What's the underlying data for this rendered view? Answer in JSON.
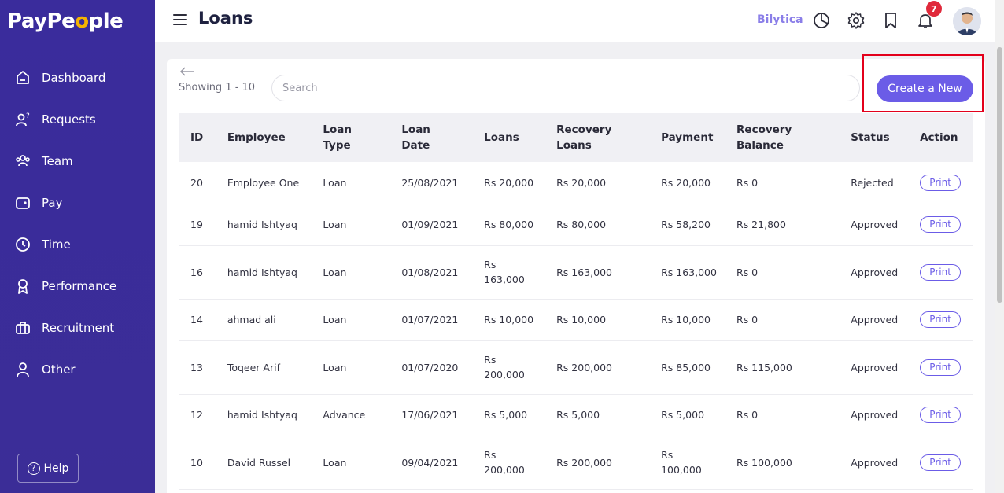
{
  "app": {
    "logo_prefix": "PayPe",
    "logo_o": "o",
    "logo_suffix": "ple"
  },
  "sidebar": {
    "items": [
      {
        "label": "Dashboard",
        "icon": "home-icon"
      },
      {
        "label": "Requests",
        "icon": "user-question-icon"
      },
      {
        "label": "Team",
        "icon": "team-icon"
      },
      {
        "label": "Pay",
        "icon": "wallet-icon"
      },
      {
        "label": "Time",
        "icon": "clock-icon"
      },
      {
        "label": "Performance",
        "icon": "award-icon"
      },
      {
        "label": "Recruitment",
        "icon": "briefcase-icon"
      },
      {
        "label": "Other",
        "icon": "user-icon"
      }
    ],
    "help_label": "Help"
  },
  "header": {
    "title": "Loans",
    "bilytica_label": "Bilytica",
    "notification_count": "7"
  },
  "toolbar": {
    "showing": "Showing 1 - 10",
    "search_placeholder": "Search",
    "create_label": "Create a New"
  },
  "table": {
    "columns": [
      "ID",
      "Employee",
      "Loan Type",
      "Loan Date",
      "Loans",
      "Recovery Loans",
      "Payment",
      "Recovery Balance",
      "Status",
      "Action"
    ],
    "rows": [
      {
        "id": "20",
        "employee": "Employee One",
        "type": "Loan",
        "date": "25/08/2021",
        "loans": "Rs 20,000",
        "recovery": "Rs 20,000",
        "payment": "Rs 20,000",
        "balance": "Rs 0",
        "status": "Rejected",
        "action": "Print"
      },
      {
        "id": "19",
        "employee": "hamid Ishtyaq",
        "type": "Loan",
        "date": "01/09/2021",
        "loans": "Rs 80,000",
        "recovery": "Rs 80,000",
        "payment": "Rs 58,200",
        "balance": "Rs 21,800",
        "status": "Approved",
        "action": "Print"
      },
      {
        "id": "16",
        "employee": "hamid Ishtyaq",
        "type": "Loan",
        "date": "01/08/2021",
        "loans": "Rs 163,000",
        "recovery": "Rs 163,000",
        "payment": "Rs 163,000",
        "balance": "Rs 0",
        "status": "Approved",
        "action": "Print"
      },
      {
        "id": "14",
        "employee": "ahmad ali",
        "type": "Loan",
        "date": "01/07/2021",
        "loans": "Rs 10,000",
        "recovery": "Rs 10,000",
        "payment": "Rs 10,000",
        "balance": "Rs 0",
        "status": "Approved",
        "action": "Print"
      },
      {
        "id": "13",
        "employee": "Toqeer Arif",
        "type": "Loan",
        "date": "01/07/2020",
        "loans": "Rs 200,000",
        "recovery": "Rs 200,000",
        "payment": "Rs 85,000",
        "balance": "Rs 115,000",
        "status": "Approved",
        "action": "Print"
      },
      {
        "id": "12",
        "employee": "hamid Ishtyaq",
        "type": "Advance",
        "date": "17/06/2021",
        "loans": "Rs 5,000",
        "recovery": "Rs 5,000",
        "payment": "Rs 5,000",
        "balance": "Rs 0",
        "status": "Approved",
        "action": "Print"
      },
      {
        "id": "10",
        "employee": "David Russel",
        "type": "Loan",
        "date": "09/04/2021",
        "loans": "Rs 200,000",
        "recovery": "Rs 200,000",
        "payment": "Rs 100,000",
        "balance": "Rs 100,000",
        "status": "Approved",
        "action": "Print"
      }
    ]
  },
  "colors": {
    "sidebar": "#3a2c9c",
    "accent": "#6b5ce7",
    "highlight": "#e3001b"
  }
}
